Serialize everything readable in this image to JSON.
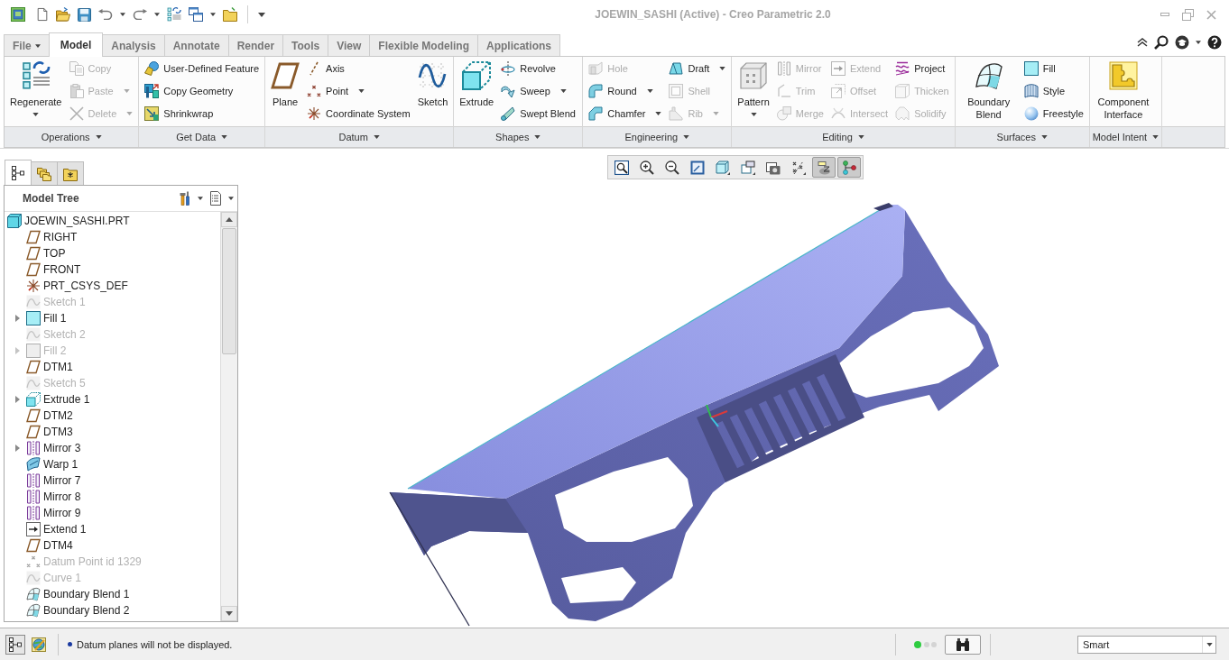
{
  "window": {
    "title": "JOEWIN_SASHI (Active) - Creo Parametric 2.0"
  },
  "tabs": [
    {
      "label": "File",
      "dropdown": true,
      "selected": false
    },
    {
      "label": "Model",
      "dropdown": false,
      "selected": true
    },
    {
      "label": "Analysis",
      "dropdown": false,
      "selected": false
    },
    {
      "label": "Annotate",
      "dropdown": false,
      "selected": false
    },
    {
      "label": "Render",
      "dropdown": false,
      "selected": false
    },
    {
      "label": "Tools",
      "dropdown": false,
      "selected": false
    },
    {
      "label": "View",
      "dropdown": false,
      "selected": false
    },
    {
      "label": "Flexible Modeling",
      "dropdown": false,
      "selected": false
    },
    {
      "label": "Applications",
      "dropdown": false,
      "selected": false
    }
  ],
  "ribbon": {
    "groups": [
      {
        "label": "Operations",
        "dropdown": true,
        "commands": [
          {
            "label": "Regenerate",
            "kind": "large",
            "dropdown": true,
            "disabled": false
          },
          {
            "label": "Copy",
            "kind": "small",
            "dropdown": false,
            "disabled": true
          },
          {
            "label": "Paste",
            "kind": "small",
            "dropdown": true,
            "disabled": true
          },
          {
            "label": "Delete",
            "kind": "small",
            "dropdown": true,
            "disabled": true
          }
        ]
      },
      {
        "label": "Get Data",
        "dropdown": true,
        "commands": [
          {
            "label": "User-Defined Feature",
            "kind": "small",
            "dropdown": false,
            "disabled": false
          },
          {
            "label": "Copy Geometry",
            "kind": "small",
            "dropdown": false,
            "disabled": false
          },
          {
            "label": "Shrinkwrap",
            "kind": "small",
            "dropdown": false,
            "disabled": false
          }
        ]
      },
      {
        "label": "Datum",
        "dropdown": true,
        "commands": [
          {
            "label": "Plane",
            "kind": "large",
            "dropdown": false,
            "disabled": false
          },
          {
            "label": "Axis",
            "kind": "small",
            "dropdown": false,
            "disabled": false
          },
          {
            "label": "Point",
            "kind": "small",
            "dropdown": true,
            "disabled": false
          },
          {
            "label": "Coordinate System",
            "kind": "small",
            "dropdown": false,
            "disabled": false
          },
          {
            "label": "Sketch",
            "kind": "large",
            "dropdown": false,
            "disabled": false
          }
        ]
      },
      {
        "label": "Shapes",
        "dropdown": true,
        "commands": [
          {
            "label": "Extrude",
            "kind": "large",
            "dropdown": false,
            "disabled": false
          },
          {
            "label": "Revolve",
            "kind": "small",
            "dropdown": false,
            "disabled": false
          },
          {
            "label": "Sweep",
            "kind": "small",
            "dropdown": true,
            "disabled": false
          },
          {
            "label": "Swept Blend",
            "kind": "small",
            "dropdown": false,
            "disabled": false
          }
        ]
      },
      {
        "label": "Engineering",
        "dropdown": true,
        "commands": [
          {
            "label": "Hole",
            "kind": "small",
            "dropdown": false,
            "disabled": true
          },
          {
            "label": "Round",
            "kind": "small",
            "dropdown": true,
            "disabled": false
          },
          {
            "label": "Chamfer",
            "kind": "small",
            "dropdown": true,
            "disabled": false
          },
          {
            "label": "Draft",
            "kind": "small",
            "dropdown": true,
            "disabled": false
          },
          {
            "label": "Shell",
            "kind": "small",
            "dropdown": false,
            "disabled": true
          },
          {
            "label": "Rib",
            "kind": "small",
            "dropdown": true,
            "disabled": true
          }
        ]
      },
      {
        "label": "Editing",
        "dropdown": true,
        "commands": [
          {
            "label": "Pattern",
            "kind": "large",
            "dropdown": true,
            "disabled": false
          },
          {
            "label": "Mirror",
            "kind": "small",
            "dropdown": false,
            "disabled": true
          },
          {
            "label": "Trim",
            "kind": "small",
            "dropdown": false,
            "disabled": true
          },
          {
            "label": "Merge",
            "kind": "small",
            "dropdown": false,
            "disabled": true
          },
          {
            "label": "Extend",
            "kind": "small",
            "dropdown": false,
            "disabled": true
          },
          {
            "label": "Offset",
            "kind": "small",
            "dropdown": false,
            "disabled": true
          },
          {
            "label": "Intersect",
            "kind": "small",
            "dropdown": false,
            "disabled": true
          },
          {
            "label": "Project",
            "kind": "small",
            "dropdown": false,
            "disabled": false
          },
          {
            "label": "Thicken",
            "kind": "small",
            "dropdown": false,
            "disabled": true
          },
          {
            "label": "Solidify",
            "kind": "small",
            "dropdown": false,
            "disabled": true
          }
        ]
      },
      {
        "label": "Surfaces",
        "dropdown": true,
        "commands": [
          {
            "label": "Boundary Blend",
            "kind": "large",
            "dropdown": false,
            "disabled": false
          },
          {
            "label": "Fill",
            "kind": "small",
            "dropdown": false,
            "disabled": false
          },
          {
            "label": "Style",
            "kind": "small",
            "dropdown": false,
            "disabled": false
          },
          {
            "label": "Freestyle",
            "kind": "small",
            "dropdown": false,
            "disabled": false
          }
        ]
      },
      {
        "label": "Model Intent",
        "dropdown": true,
        "commands": [
          {
            "label": "Component Interface",
            "kind": "large",
            "dropdown": false,
            "disabled": false
          }
        ]
      }
    ]
  },
  "model_tree": {
    "tabs": [
      {
        "selected": true
      },
      {
        "selected": false
      },
      {
        "selected": false
      }
    ],
    "title": "Model Tree",
    "items": [
      {
        "label": "JOEWIN_SASHI.PRT",
        "kind": "part",
        "expandable": false,
        "dimmed": false,
        "children": [
          {
            "label": "RIGHT",
            "kind": "plane",
            "expandable": false,
            "dimmed": false
          },
          {
            "label": "TOP",
            "kind": "plane",
            "expandable": false,
            "dimmed": false
          },
          {
            "label": "FRONT",
            "kind": "plane",
            "expandable": false,
            "dimmed": false
          },
          {
            "label": "PRT_CSYS_DEF",
            "kind": "csys",
            "expandable": false,
            "dimmed": false
          },
          {
            "label": "Sketch 1",
            "kind": "sketch",
            "expandable": false,
            "dimmed": true
          },
          {
            "label": "Fill 1",
            "kind": "fill",
            "expandable": true,
            "dimmed": false
          },
          {
            "label": "Sketch 2",
            "kind": "sketch",
            "expandable": false,
            "dimmed": true
          },
          {
            "label": "Fill 2",
            "kind": "fill",
            "expandable": true,
            "dimmed": true
          },
          {
            "label": "DTM1",
            "kind": "plane",
            "expandable": false,
            "dimmed": false
          },
          {
            "label": "Sketch 5",
            "kind": "sketch",
            "expandable": false,
            "dimmed": true
          },
          {
            "label": "Extrude 1",
            "kind": "extrude",
            "expandable": true,
            "dimmed": false
          },
          {
            "label": "DTM2",
            "kind": "plane",
            "expandable": false,
            "dimmed": false
          },
          {
            "label": "DTM3",
            "kind": "plane",
            "expandable": false,
            "dimmed": false
          },
          {
            "label": "Mirror 3",
            "kind": "mirror",
            "expandable": true,
            "dimmed": false
          },
          {
            "label": "Warp 1",
            "kind": "warp",
            "expandable": false,
            "dimmed": false
          },
          {
            "label": "Mirror 7",
            "kind": "mirror",
            "expandable": false,
            "dimmed": false
          },
          {
            "label": "Mirror 8",
            "kind": "mirror",
            "expandable": false,
            "dimmed": false
          },
          {
            "label": "Mirror 9",
            "kind": "mirror",
            "expandable": false,
            "dimmed": false
          },
          {
            "label": "Extend 1",
            "kind": "extend",
            "expandable": false,
            "dimmed": false
          },
          {
            "label": "DTM4",
            "kind": "plane",
            "expandable": false,
            "dimmed": false
          },
          {
            "label": "Datum Point id 1329",
            "kind": "point",
            "expandable": false,
            "dimmed": true
          },
          {
            "label": "Curve 1",
            "kind": "curve",
            "expandable": false,
            "dimmed": true
          },
          {
            "label": "Boundary Blend 1",
            "kind": "blend",
            "expandable": false,
            "dimmed": false
          },
          {
            "label": "Boundary Blend 2",
            "kind": "blend",
            "expandable": false,
            "dimmed": false
          }
        ]
      }
    ]
  },
  "view_toolbar": [
    {
      "on": false
    },
    {
      "on": false
    },
    {
      "on": false
    },
    {
      "on": false
    },
    {
      "on": false
    },
    {
      "on": false
    },
    {
      "on": false
    },
    {
      "on": false
    },
    {
      "on": true
    },
    {
      "on": true
    }
  ],
  "status_bar": {
    "toggles": [
      {
        "on": true
      },
      {
        "on": false
      }
    ],
    "message": "Datum planes will not be displayed.",
    "selection_filter": "Smart"
  }
}
